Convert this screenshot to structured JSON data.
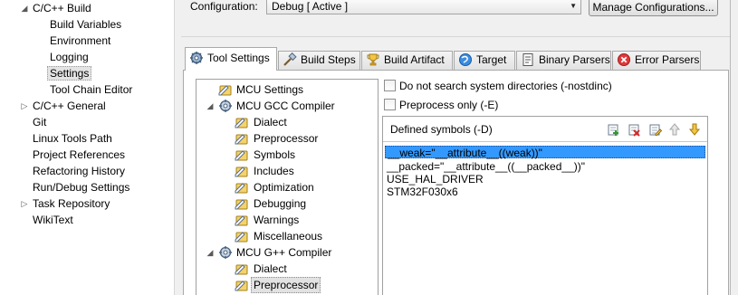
{
  "sidebar": {
    "items": [
      {
        "label": "C/C++ Build",
        "twisty": "expanded"
      },
      {
        "label": "Build Variables"
      },
      {
        "label": "Environment"
      },
      {
        "label": "Logging"
      },
      {
        "label": "Settings",
        "selected": true
      },
      {
        "label": "Tool Chain Editor"
      },
      {
        "label": "C/C++ General",
        "twisty": "collapsed"
      },
      {
        "label": "Git"
      },
      {
        "label": "Linux Tools Path"
      },
      {
        "label": "Project References"
      },
      {
        "label": "Refactoring History"
      },
      {
        "label": "Run/Debug Settings"
      },
      {
        "label": "Task Repository",
        "twisty": "collapsed"
      },
      {
        "label": "WikiText"
      }
    ]
  },
  "config": {
    "label": "Configuration:",
    "value": "Debug  [ Active ]",
    "manage_label": "Manage Configurations..."
  },
  "tabs": [
    {
      "label": "Tool Settings",
      "icon": "tool-settings-icon",
      "active": true
    },
    {
      "label": "Build Steps",
      "icon": "build-steps-icon"
    },
    {
      "label": "Build Artifact",
      "icon": "build-artifact-icon"
    },
    {
      "label": "Target",
      "icon": "target-icon"
    },
    {
      "label": "Binary Parsers",
      "icon": "binary-parsers-icon"
    },
    {
      "label": "Error Parsers",
      "icon": "error-parsers-icon"
    }
  ],
  "tool_tree": {
    "items": [
      {
        "label": "MCU Settings",
        "icon": "settings-page-icon"
      },
      {
        "label": "MCU GCC Compiler",
        "icon": "tool-gear-icon",
        "twisty": "expanded"
      },
      {
        "label": "Dialect",
        "icon": "settings-page-icon"
      },
      {
        "label": "Preprocessor",
        "icon": "settings-page-icon"
      },
      {
        "label": "Symbols",
        "icon": "settings-page-icon"
      },
      {
        "label": "Includes",
        "icon": "settings-page-icon"
      },
      {
        "label": "Optimization",
        "icon": "settings-page-icon"
      },
      {
        "label": "Debugging",
        "icon": "settings-page-icon"
      },
      {
        "label": "Warnings",
        "icon": "settings-page-icon"
      },
      {
        "label": "Miscellaneous",
        "icon": "settings-page-icon"
      },
      {
        "label": "MCU G++ Compiler",
        "icon": "tool-gear-icon",
        "twisty": "expanded"
      },
      {
        "label": "Dialect",
        "icon": "settings-page-icon"
      },
      {
        "label": "Preprocessor",
        "icon": "settings-page-icon",
        "selected": true
      }
    ]
  },
  "options": {
    "nostdinc_label": "Do not search system directories (-nostdinc)",
    "nostdinc_checked": false,
    "preprocess_label": "Preprocess only (-E)",
    "preprocess_checked": false
  },
  "symbols": {
    "title": "Defined symbols (-D)",
    "toolbar_icons": [
      "add-icon",
      "delete-icon",
      "edit-icon",
      "move-up-icon",
      "move-down-icon"
    ],
    "items": [
      "__weak=\"__attribute__((weak))\"",
      "__packed=\"__attribute__((__packed__))\"",
      "USE_HAL_DRIVER",
      "STM32F030x6"
    ],
    "selected_index": 0
  },
  "colors": {
    "selection": "#3399ff",
    "panel_bg": "#ffffff",
    "window_bg": "#f0f0f0"
  }
}
